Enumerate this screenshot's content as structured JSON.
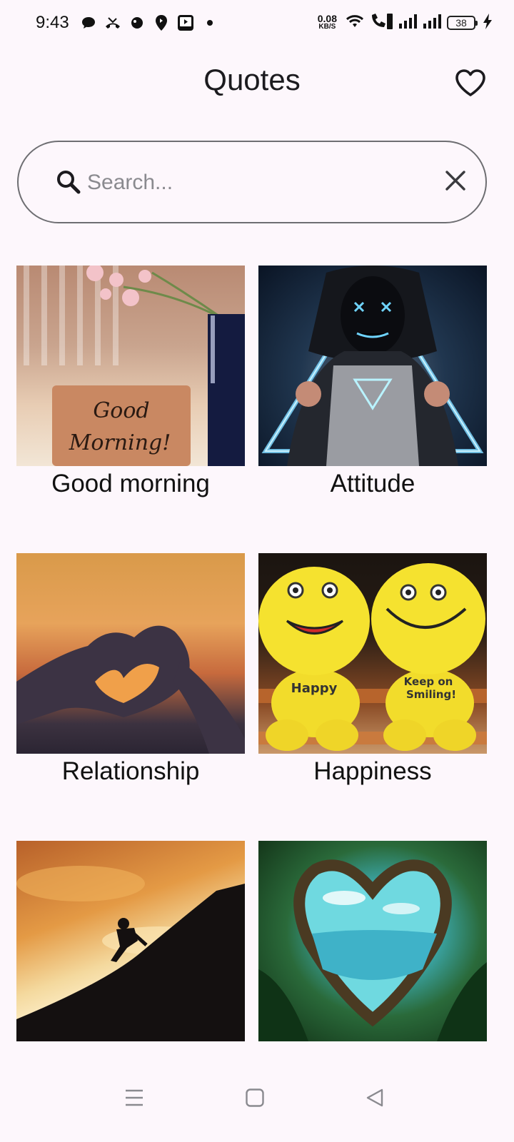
{
  "status_bar": {
    "time": "9:43",
    "net_speed_value": "0.08",
    "net_speed_unit": "KB/S",
    "battery_level": "38"
  },
  "app_bar": {
    "title": "Quotes",
    "favorite_icon": "heart-outline-icon"
  },
  "search": {
    "placeholder": "Search...",
    "value": "",
    "search_icon": "search-icon",
    "clear_icon": "close-icon"
  },
  "categories": [
    {
      "label": "Good morning",
      "image": "good-morning-sign-flowers"
    },
    {
      "label": "Attitude",
      "image": "hooded-figure-neon-mask"
    },
    {
      "label": "Relationship",
      "image": "hands-heart-sunset"
    },
    {
      "label": "Happiness",
      "image": "smiley-plush-toys"
    },
    {
      "label": "",
      "image": "silhouette-climbing-hill"
    },
    {
      "label": "",
      "image": "heart-shaped-trees-sea"
    }
  ],
  "nav_bar": {
    "menu_icon": "menu-icon",
    "home_icon": "home-square-icon",
    "back_icon": "back-triangle-icon"
  },
  "colors": {
    "background": "#fdf7fc",
    "text": "#1c1b1f",
    "outline": "#6e6e72"
  }
}
